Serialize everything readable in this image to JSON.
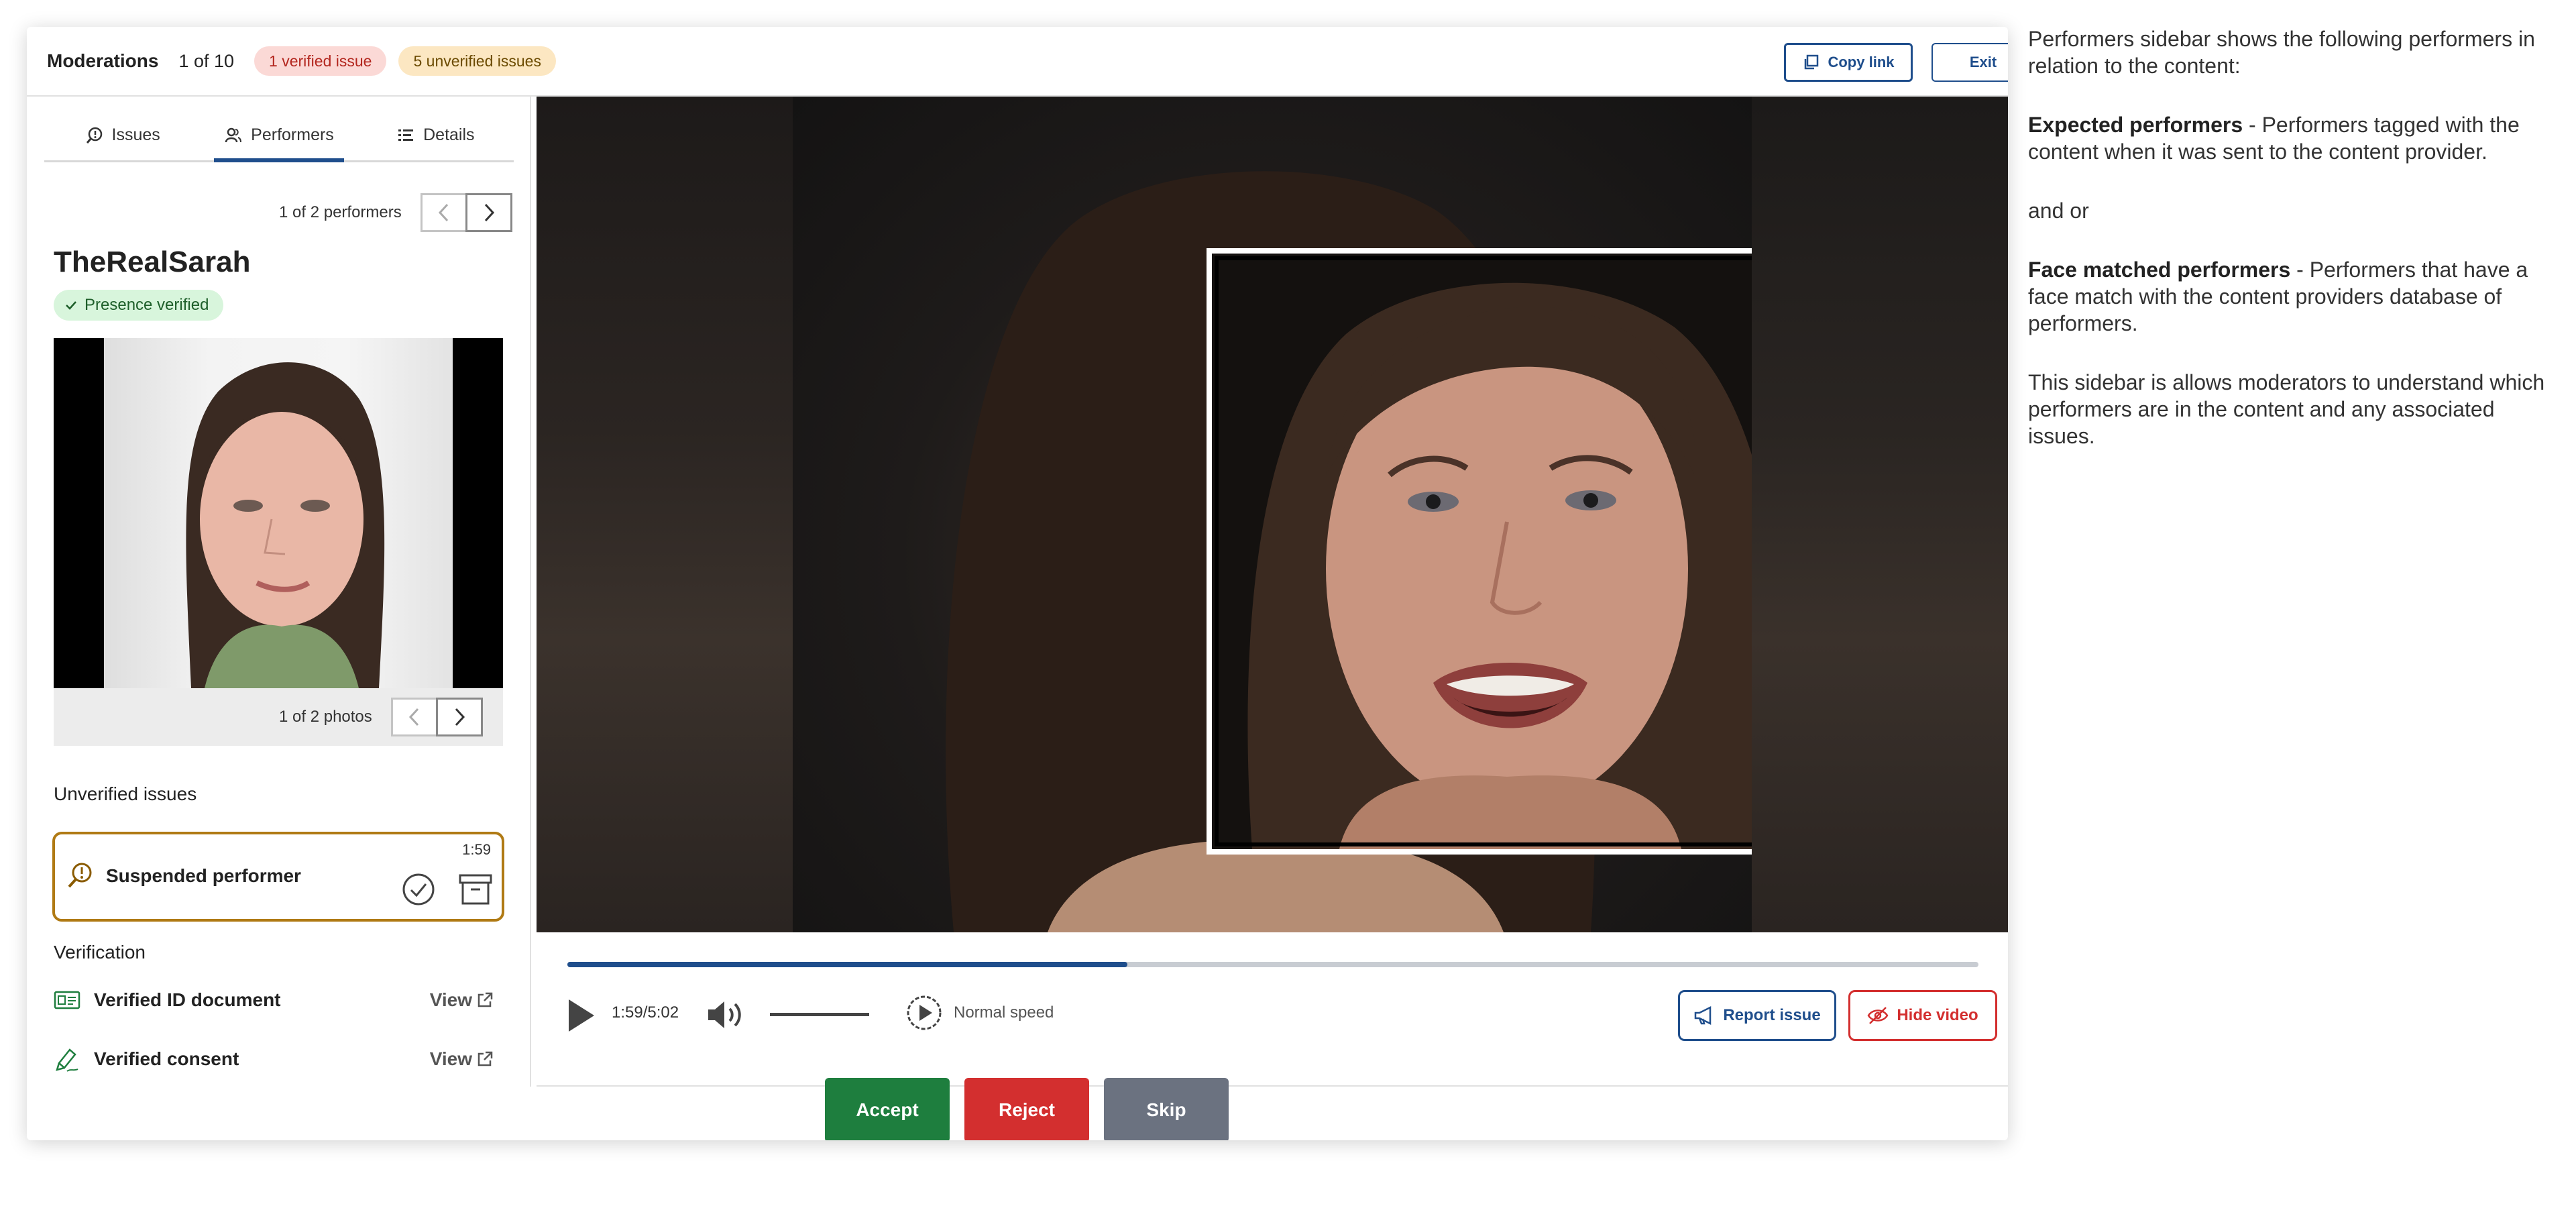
{
  "header": {
    "title": "Moderations",
    "count": "1 of 10",
    "verified_pill": "1 verified issue",
    "unverified_pill": "5 unverified issues",
    "copy_link": "Copy link",
    "exit": "Exit"
  },
  "sidebar": {
    "tabs": [
      {
        "label": "Issues",
        "icon": "magnifier-alert-icon"
      },
      {
        "label": "Performers",
        "icon": "people-icon"
      },
      {
        "label": "Details",
        "icon": "list-icon"
      }
    ],
    "active_tab": "Performers",
    "performer_pager": "1 of 2 performers",
    "performer_name": "TheRealSarah",
    "presence_badge": "Presence verified",
    "photo_pager": "1 of 2 photos",
    "unverified_label": "Unverified issues",
    "issue": {
      "label": "Suspended performer",
      "time": "1:59"
    },
    "verification_label": "Verification",
    "verification_items": [
      {
        "label": "Verified ID document",
        "action": "View"
      },
      {
        "label": "Verified consent",
        "action": "View"
      }
    ]
  },
  "player": {
    "progress": 0.397,
    "time": "1:59/5:02",
    "speed": "Normal speed",
    "report_issue": "Report issue",
    "hide_video": "Hide video"
  },
  "actions": {
    "accept": "Accept",
    "reject": "Reject",
    "skip": "Skip"
  },
  "notes": {
    "p1": "Performers sidebar shows the following performers in relation to the content:",
    "p2_bold": "Expected performers",
    "p2_rest": " - Performers tagged with the content when it was sent to the content provider.",
    "p3": "and or",
    "p4_bold": "Face matched performers",
    "p4_rest": " - Performers that have a face match with the content providers database of performers.",
    "p5": "This sidebar is allows moderators to understand which performers are in the content and any associated issues."
  },
  "colors": {
    "accent": "#1f4e8c",
    "accept": "#1e7e3e",
    "reject": "#d32f2f",
    "skip": "#6b7280",
    "issue_border": "#b07a14"
  }
}
